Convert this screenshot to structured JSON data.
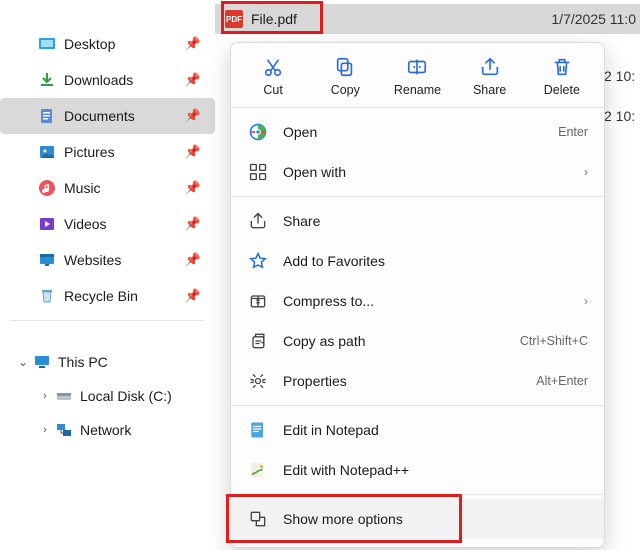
{
  "file": {
    "name": "File.pdf",
    "date": "1/7/2025 11:0"
  },
  "extra_dates": [
    "2 10:",
    "2 10:"
  ],
  "sidebar": {
    "items": [
      {
        "label": "Desktop"
      },
      {
        "label": "Downloads"
      },
      {
        "label": "Documents"
      },
      {
        "label": "Pictures"
      },
      {
        "label": "Music"
      },
      {
        "label": "Videos"
      },
      {
        "label": "Websites"
      },
      {
        "label": "Recycle Bin"
      }
    ],
    "pc": {
      "label": "This PC",
      "local_disk": "Local Disk (C:)",
      "network": "Network"
    }
  },
  "toolbar": {
    "cut": "Cut",
    "copy": "Copy",
    "rename": "Rename",
    "share": "Share",
    "delete": "Delete"
  },
  "menu": {
    "open": "Open",
    "open_hint": "Enter",
    "open_with": "Open with",
    "share": "Share",
    "favorites": "Add to Favorites",
    "compress": "Compress to...",
    "copy_path": "Copy as path",
    "copy_path_hint": "Ctrl+Shift+C",
    "properties": "Properties",
    "properties_hint": "Alt+Enter",
    "edit_notepad": "Edit in Notepad",
    "edit_npp": "Edit with Notepad++",
    "show_more": "Show more options"
  }
}
